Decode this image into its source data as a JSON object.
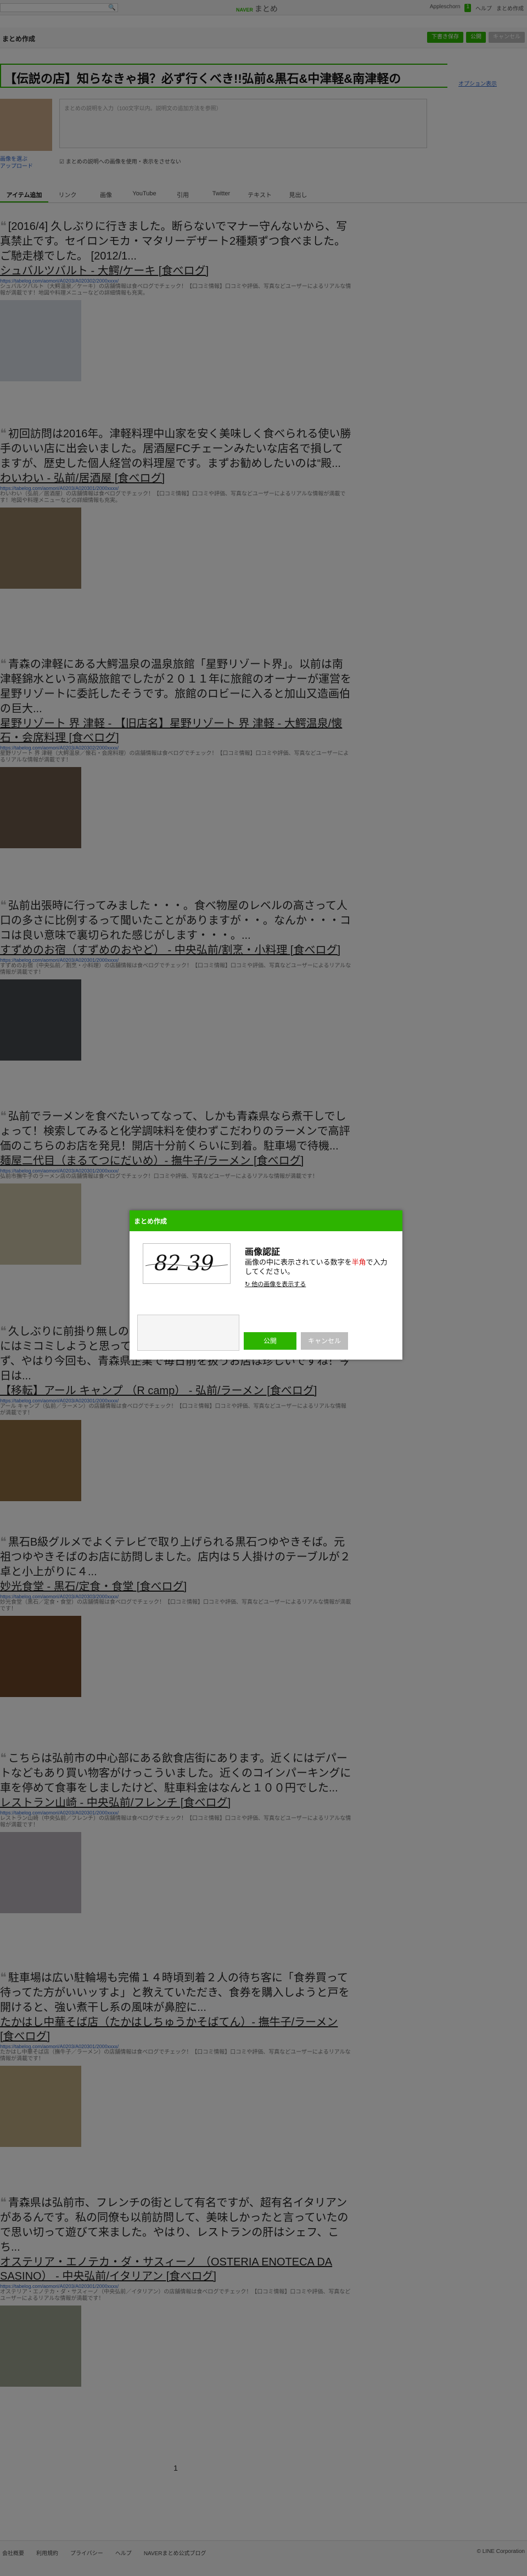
{
  "topbar": {
    "search_icon": "🔍",
    "brand_prefix": "NAVER",
    "brand": "まとめ",
    "links": [
      "Appleschorn",
      "1",
      "ヘルプ",
      "まとめ作成"
    ]
  },
  "header": {
    "logo": "まとめ作成",
    "buttons": [
      "下書き保存",
      "公開",
      "キャンセル"
    ]
  },
  "title": "【伝説の店】知らなきゃ損？必ず行くべき!!弘前&黒石&中津軽&南津軽の",
  "optional_link": "オプション表示",
  "description": {
    "placeholder": "まとめの説明を入力（100文字以内。説明文の追加方法を参照）",
    "image_links": [
      "画像を選ぶ",
      "アップロード"
    ],
    "checkbox_label": "まとめの説明への画像を使用・表示をさせない"
  },
  "tabs": [
    "アイテム追加",
    "リンク",
    "画像",
    "YouTube",
    "引用",
    "Twitter",
    "テキスト",
    "見出し"
  ],
  "items": [
    {
      "quote": "[2016/4] 久しぶりに行きました。断らないでマナー守んないから、写真禁止です。セイロンモカ・マタリーデザート2種類ずつ食べました。ご馳走様でした。 [2012/1...",
      "title": "シュバルツバルト - 大鰐/ケーキ [食べログ]",
      "url": "https://tabelog.com/aomori/A0203/A020302/2000xxxx/",
      "snippet": "シュバルツバルト（大鰐温泉／ケーキ）の店舗情報は食べログでチェック！【口コミ情報】口コミや評価、写真などユーザーによるリアルな情報が満載です！地図や料理メニューなどの詳細情報も充実。",
      "thumb": "#d7dce4"
    },
    {
      "quote": "初回訪問は2016年。津軽料理中山家を安く美味しく食べられる使い勝手のいい店に出会いました。居酒屋FCチェーンみたいな店名で損してますが、歴史した個人経営の料理屋です。まずお勧めしたいのは“殿...",
      "title": "わいわい - 弘前/居酒屋 [食べログ]",
      "url": "https://tabelog.com/aomori/A0203/A020301/2000xxxx/",
      "snippet": "わいわい（弘前／居酒屋）の店舗情報は食べログでチェック！【口コミ情報】口コミや評価、写真などユーザーによるリアルな情報が満載です！地図や料理メニューなどの詳細情報も充実。",
      "thumb": "#8f7a5e"
    },
    {
      "quote": "青森の津軽にある大鰐温泉の温泉旅館「星野リゾート界」。以前は南津軽錦水という高級旅館でしたが２０１１年に旅館のオーナーが運営を星野リゾートに委託したそうです。旅館のロビーに入ると加山又造画伯の巨大...",
      "title": "星野リゾート 界 津軽 - 【旧店名】星野リゾート 界 津軽 - 大鰐温泉/懐石・会席料理 [食べログ]",
      "url": "https://tabelog.com/aomori/A0203/A020302/2000xxxx/",
      "snippet": "星野リゾート 界 津軽（大鰐温泉／懐石・会席料理）の店舗情報は食べログでチェック！【口コミ情報】口コミや評価、写真などユーザーによるリアルな情報が満載です！",
      "thumb": "#6b5848"
    },
    {
      "quote": "弘前出張時に行ってみました・・・。食べ物屋のレベルの高さって人口の多さに比例するって聞いたことがありますが・・。なんか・・・ココは良い意味で裏切られた感じがします・・・。...",
      "title": "すずめのお宿（すずめのおやど） - 中央弘前/割烹・小料理 [食べログ]",
      "url": "https://tabelog.com/aomori/A0203/A020301/2000xxxx/",
      "snippet": "すずめのお宿（中央弘前／割烹・小料理）の店舗情報は食べログでチェック！【口コミ情報】口コミや評価、写真などユーザーによるリアルな情報が満載です！",
      "thumb": "#44484d"
    },
    {
      "quote": "弘前でラーメンを食べたいってなって、しかも青森県なら煮干しでしょって！検索してみると化学調味料を使わずこだわりのラーメンで高評価のこちらのお店を発見！開店十分前くらいに到着。駐車場で待機...",
      "title": "麺屋二代目（まるてつにだいめ）- 撫牛子/ラーメン [食べログ]",
      "url": "https://tabelog.com/aomori/A0203/A020301/2000xxxx/",
      "snippet": "弘前市撫牛子のラーメン店の店舗情報は食べログでチェック！口コミや評価、写真などユーザーによるリアルな情報が満載です！",
      "thumb": "#c8c0a4"
    },
    {
      "quote": "久しぶりに前掛り無しのラーメン屋に来ました。先日で訪問したときにはミコミしようと思っていたのですが、ちょっと弘前の雰囲気に合わず、やはり今回も、青森県企業で毎日前を扱うお店は珍しいですね！今日は...",
      "title": "【移転】アール キャンプ （R camp） - 弘前/ラーメン [食べログ]",
      "url": "https://tabelog.com/aomori/A0203/A020301/2000xxxx/",
      "snippet": "アール キャンプ（弘前／ラーメン）の店舗情報は食べログでチェック！【口コミ情報】口コミや評価、写真などユーザーによるリアルな情報が満載です！",
      "thumb": "#8a6a3f"
    },
    {
      "quote": "黒石B級グルメでよくテレビで取り上げられる黒石つゆやきそば。元祖つゆやきそばのお店に訪問しました。店内は５人掛けのテーブルが２卓と小上がりに４...",
      "title": "妙光食堂 - 黒石/定食・食堂 [食べログ]",
      "url": "https://tabelog.com/aomori/A0203/A020303/2000xxxx/",
      "snippet": "妙光食堂（黒石／定食・食堂）の店舗情報は食べログでチェック！【口コミ情報】口コミや評価、写真などユーザーによるリアルな情報が満載です！",
      "thumb": "#6a4526"
    },
    {
      "quote": "こちらは弘前市の中心部にある飲食店街にあります。近くにはデパートなどもあり買い物客がけっこういました。近くのコインパーキングに車を停めて食事をしましたけど、駐車料金はなんと１００円でした...",
      "title": "レストラン山崎 - 中央弘前/フレンチ [食べログ]",
      "url": "https://tabelog.com/aomori/A0203/A020301/2000xxxx/",
      "snippet": "レストラン山崎（中央弘前／フレンチ）の店舗情報は食べログでチェック！【口コミ情報】口コミや評価、写真などユーザーによるリアルな情報が満載です！",
      "thumb": "#b7b0b8"
    },
    {
      "quote": "駐車場は広い駐輪場も完備１４時頃到着２人の待ち客に「食券買って待ってた方がいいッすよ」と教えていただき、食券を購入しようと戸を開けると、強い煮干し系の風味が鼻腔に...",
      "title": "たかはし中華そば店（たかはしちゅうかそばてん）- 撫牛子/ラーメン [食べログ]",
      "url": "https://tabelog.com/aomori/A0203/A020301/2000xxxx/",
      "snippet": "たかはし中華そば店（撫牛子／ラーメン）の店舗情報は食べログでチェック！【口コミ情報】口コミや評価、写真などユーザーによるリアルな情報が満載です！",
      "thumb": "#b9a77e"
    },
    {
      "quote": "青森県は弘前市、フレンチの街として有名ですが、超有名イタリアンがあるんです。私の同僚も以前訪問して、美味しかったと言っていたので思い切って遊びて来ました。やはり、レストランの肝はシェフ、こち...",
      "title": "オステリア・エノテカ・ダ・サスィーノ （OSTERIA ENOTECA DA SASINO） - 中央弘前/イタリアン [食べログ]",
      "url": "https://tabelog.com/aomori/A0203/A020301/2000xxxx/",
      "snippet": "オステリア・エノテカ・ダ・サスィーノ（中央弘前／イタリアン）の店舗情報は食べログでチェック！【口コミ情報】口コミや評価、写真などユーザーによるリアルな情報が満載です！",
      "thumb": "#9aa08e"
    }
  ],
  "pager": "1",
  "footer": {
    "links": [
      "会社概要",
      "利用規約",
      "プライバシー",
      "ヘルプ",
      "NAVERまとめ公式ブログ"
    ],
    "copy": "© LINE Corporation"
  },
  "modal": {
    "header": "まとめ作成",
    "captcha_text": "82 39",
    "title": "画像認証",
    "desc_before": "画像の中に表示されている数字を",
    "desc_red": "半角",
    "desc_after": "で入力してください。",
    "refresh": "他の画像を表示する",
    "submit": "公開",
    "cancel": "キャンセル"
  }
}
